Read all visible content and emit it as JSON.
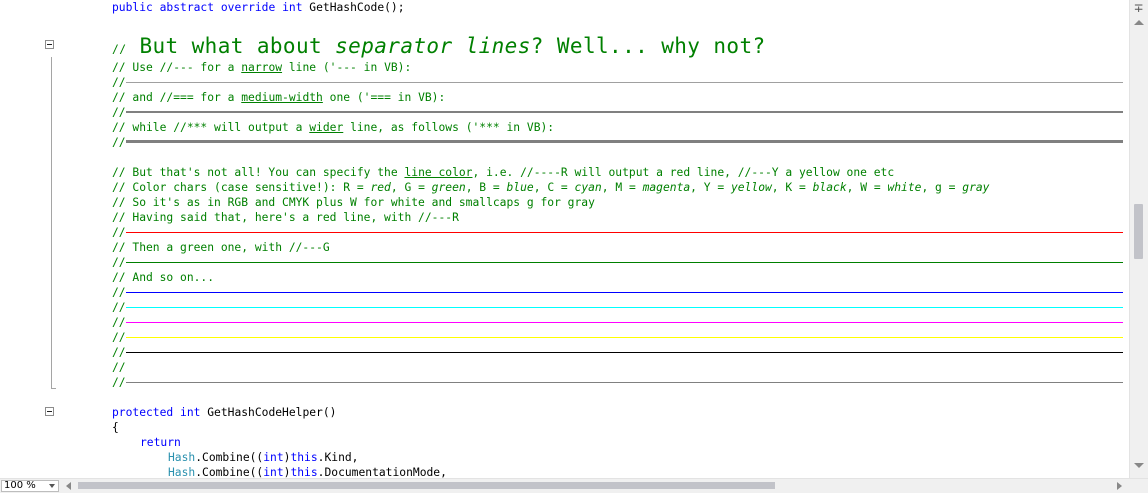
{
  "code": {
    "getHashCode": {
      "kw1": "public",
      "kw2": "abstract",
      "kw3": "override",
      "kw4": "int",
      "rest": " GetHashCode();"
    },
    "heading": {
      "prefix": "//",
      "a": " But what about ",
      "b": "separator lines",
      "c": "? Well... why not?"
    },
    "narrow": {
      "a": "// Use //--- for a ",
      "b": "narrow",
      "c": " line ('--- in VB):"
    },
    "medium": {
      "a": "// and //=== for a ",
      "b": "medium-width",
      "c": " one ('=== in VB):"
    },
    "wider": {
      "a": "// while //*** will output a ",
      "b": "wider",
      "c": " line, as follows ('*** in VB):"
    },
    "color1": {
      "a": "// But that's not all! You can specify the ",
      "b": "line color",
      "c": ", i.e. //----R will output a red line, //---Y a yellow one etc"
    },
    "color2": {
      "a": "// Color chars (case sensitive!): R = ",
      "b": "red",
      "c": ", G = ",
      "d": "green",
      "e": ", B = ",
      "f": "blue",
      "g": ", C = ",
      "h": "cyan",
      "i": ", M = ",
      "j": "magenta",
      "k": ", Y = ",
      "l": "yellow",
      "m": ", K = ",
      "n": "black",
      "o": ", W = ",
      "p": "white",
      "q": ", g = ",
      "r": "gray"
    },
    "color3": "// So it's as in RGB and CMYK plus W for white and smallcaps g for gray",
    "color4": "// Having said that, here's a red line, with //---R",
    "green_intro": "// Then a green one, with //---G",
    "so_on": "// And so on...",
    "slashes": "//",
    "helper": {
      "kw1": "protected",
      "kw2": "int",
      "rest": " GetHashCodeHelper()"
    },
    "brace": "{",
    "ret": "return",
    "combine1": {
      "type": "Hash",
      "a": ".Combine((",
      "kw": "int",
      "b": ")",
      "this": "this",
      "c": ".Kind,"
    },
    "combine2": {
      "type": "Hash",
      "a": ".Combine((",
      "kw": "int",
      "b": ")",
      "this": "this",
      "c": ".DocumentationMode,"
    }
  },
  "separator_colors": {
    "narrow": "#a0a0a0",
    "medium": "#808080",
    "wide": "#808080",
    "red": "#ff0000",
    "green": "#008000",
    "blue": "#0000ff",
    "cyan": "#00ffff",
    "magenta": "#ff00ff",
    "yellow": "#ffff00",
    "black": "#000000",
    "white": "#ffffff",
    "gray": "#808080"
  },
  "zoom": {
    "value": "100 %"
  },
  "icons": {
    "fold": "minus-box-icon",
    "split": "split-view-icon"
  }
}
